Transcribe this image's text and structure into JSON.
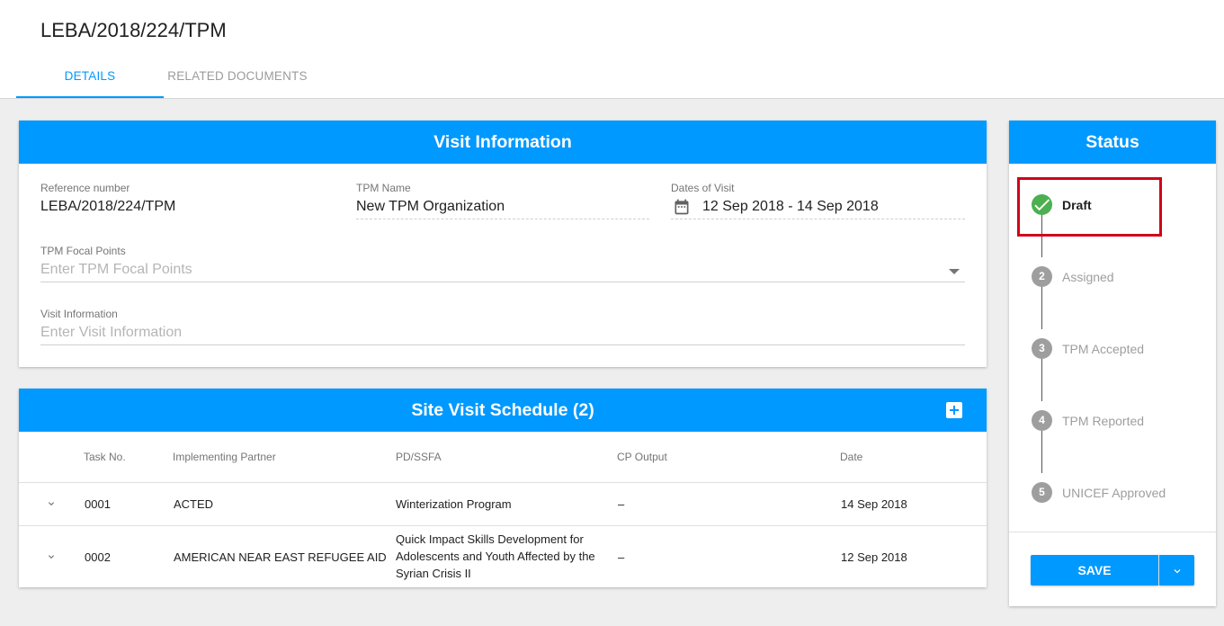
{
  "header": {
    "title": "LEBA/2018/224/TPM",
    "tabs": [
      {
        "label": "DETAILS",
        "active": true
      },
      {
        "label": "RELATED DOCUMENTS",
        "active": false
      }
    ]
  },
  "visit_information": {
    "title": "Visit Information",
    "reference_number": {
      "label": "Reference number",
      "value": "LEBA/2018/224/TPM"
    },
    "tpm_name": {
      "label": "TPM Name",
      "value": "New TPM Organization"
    },
    "dates_of_visit": {
      "label": "Dates of Visit",
      "value": "12 Sep 2018 - 14 Sep 2018"
    },
    "tpm_focal_points": {
      "label": "TPM Focal Points",
      "placeholder": "Enter TPM Focal Points"
    },
    "visit_info": {
      "label": "Visit Information",
      "placeholder": "Enter Visit Information"
    }
  },
  "site_visit_schedule": {
    "title": "Site Visit Schedule (2)",
    "columns": [
      "Task No.",
      "Implementing Partner",
      "PD/SSFA",
      "CP Output",
      "Date"
    ],
    "rows": [
      {
        "task_no": "0001",
        "partner": "ACTED",
        "pd_ssfa": "Winterization Program",
        "cp_output": "–",
        "date": "14 Sep 2018"
      },
      {
        "task_no": "0002",
        "partner": "AMERICAN NEAR EAST REFUGEE AID",
        "pd_ssfa_lines": [
          "Quick Impact Skills Development for",
          "Adolescents and Youth Affected by the",
          "Syrian Crisis II"
        ],
        "cp_output": "–",
        "date": "12 Sep 2018"
      }
    ]
  },
  "status": {
    "title": "Status",
    "steps": [
      {
        "number": "1",
        "label": "Draft",
        "state": "done"
      },
      {
        "number": "2",
        "label": "Assigned",
        "state": "pending"
      },
      {
        "number": "3",
        "label": "TPM Accepted",
        "state": "pending"
      },
      {
        "number": "4",
        "label": "TPM Reported",
        "state": "pending"
      },
      {
        "number": "5",
        "label": "UNICEF Approved",
        "state": "pending"
      }
    ],
    "save_label": "SAVE"
  },
  "colors": {
    "primary": "#0099ff",
    "done": "#4caf50",
    "pending": "#9e9e9e",
    "highlight": "#d0021b"
  },
  "icons": {
    "calendar": "calendar-icon",
    "dropdown": "dropdown-arrow-icon",
    "add": "add-icon",
    "expand": "chevron-down-icon",
    "check": "check-icon"
  }
}
